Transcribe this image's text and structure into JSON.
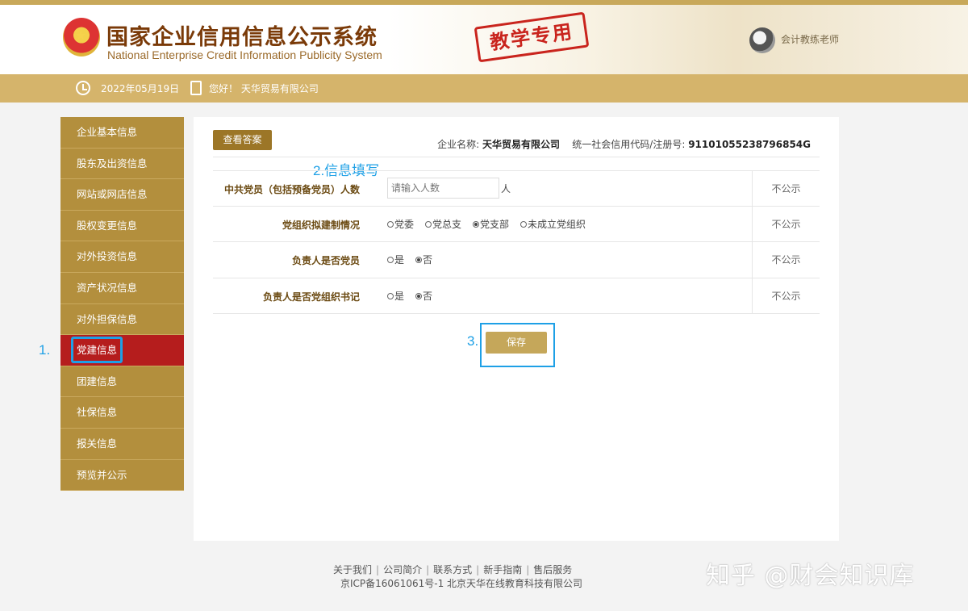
{
  "header": {
    "title_cn": "国家企业信用信息公示系统",
    "title_en": "National Enterprise Credit Information Publicity System",
    "stamp": "教学专用",
    "teacher": "会计教练老师"
  },
  "infobar": {
    "date": "2022年05月19日",
    "greeting": "您好！ 天华贸易有限公司"
  },
  "sidebar": {
    "items": [
      {
        "label": "企业基本信息"
      },
      {
        "label": "股东及出资信息"
      },
      {
        "label": "网站或网店信息"
      },
      {
        "label": "股权变更信息"
      },
      {
        "label": "对外投资信息"
      },
      {
        "label": "资产状况信息"
      },
      {
        "label": "对外担保信息"
      },
      {
        "label": "党建信息"
      },
      {
        "label": "团建信息"
      },
      {
        "label": "社保信息"
      },
      {
        "label": "报关信息"
      },
      {
        "label": "预览并公示"
      }
    ],
    "active_index": 7
  },
  "annotations": {
    "step1": "1.",
    "step2": "2.信息填写",
    "step3": "3."
  },
  "panel": {
    "answer_button": "查看答案",
    "company_label": "企业名称:",
    "company_name": "天华贸易有限公司",
    "credit_label": "统一社会信用代码/注册号:",
    "credit_code": "91101055238796854G",
    "save_button": "保存"
  },
  "form": {
    "rows": [
      {
        "label": "中共党员（包括预备党员）人数",
        "input_placeholder": "请输入人数",
        "unit": "人",
        "publicity": "不公示"
      },
      {
        "label": "党组织拟建制情况",
        "options": [
          "党委",
          "党总支",
          "党支部",
          "未成立党组织"
        ],
        "selected": "党支部",
        "publicity": "不公示"
      },
      {
        "label": "负责人是否党员",
        "options": [
          "是",
          "否"
        ],
        "selected": "否",
        "publicity": "不公示"
      },
      {
        "label": "负责人是否党组织书记",
        "options": [
          "是",
          "否"
        ],
        "selected": "否",
        "publicity": "不公示"
      }
    ]
  },
  "footer": {
    "links": [
      "关于我们",
      "公司简介",
      "联系方式",
      "新手指南",
      "售后服务"
    ],
    "icp": "京ICP备16061061号-1 北京天华在线教育科技有限公司"
  },
  "watermark": "知乎 @财会知识库"
}
